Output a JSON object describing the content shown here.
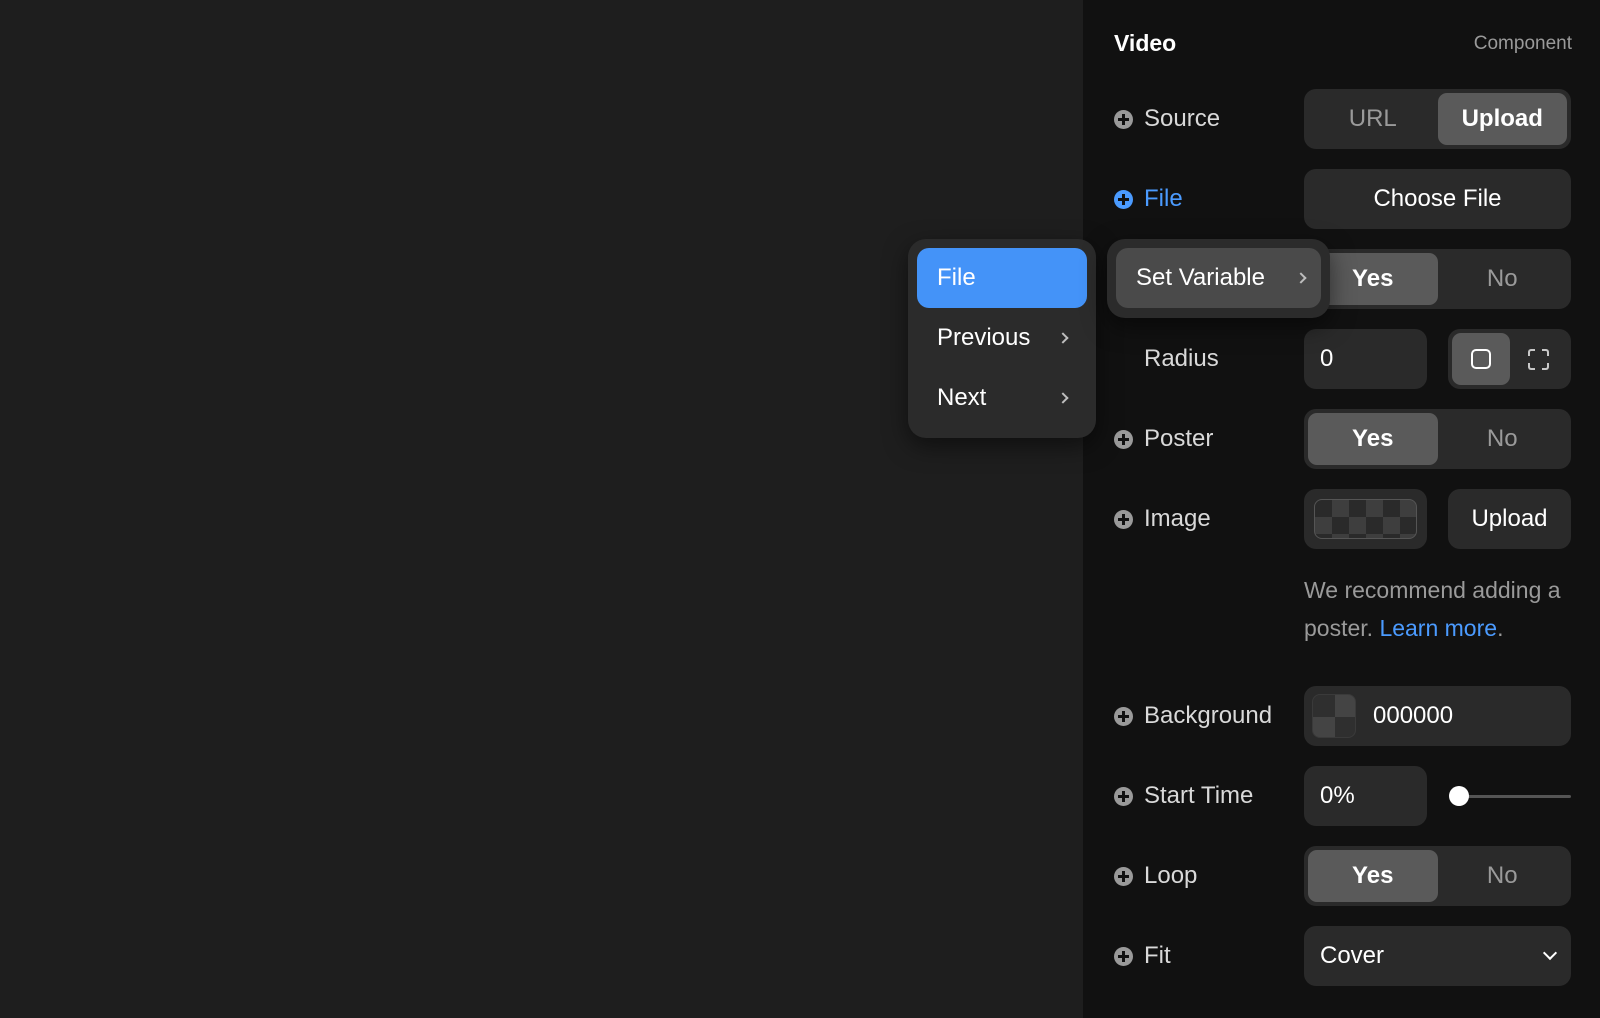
{
  "panel": {
    "title": "Video",
    "subtitle": "Component",
    "source": {
      "label": "Source",
      "options": [
        "URL",
        "Upload"
      ],
      "selected": "Upload"
    },
    "file": {
      "label": "File",
      "button": "Choose File"
    },
    "autoplay": {
      "options": [
        "Yes",
        "No"
      ],
      "selected": "Yes"
    },
    "radius": {
      "label": "Radius",
      "value": "0"
    },
    "poster": {
      "label": "Poster",
      "options": [
        "Yes",
        "No"
      ],
      "selected": "Yes"
    },
    "image": {
      "label": "Image",
      "button": "Upload"
    },
    "hint": {
      "text": "We recommend adding a poster. ",
      "link": "Learn more",
      "after": "."
    },
    "background": {
      "label": "Background",
      "value": "000000"
    },
    "start_time": {
      "label": "Start Time",
      "value": "0%",
      "slider_fraction": 0
    },
    "loop": {
      "label": "Loop",
      "options": [
        "Yes",
        "No"
      ],
      "selected": "Yes"
    },
    "fit": {
      "label": "Fit",
      "value": "Cover"
    }
  },
  "menu": {
    "items": [
      {
        "label": "File",
        "selected": true,
        "has_submenu": false
      },
      {
        "label": "Previous",
        "selected": false,
        "has_submenu": true
      },
      {
        "label": "Next",
        "selected": false,
        "has_submenu": true
      }
    ],
    "submenu": {
      "label": "Set Variable"
    }
  },
  "colors": {
    "accent": "#4b9bff",
    "menu_selected": "#4493f8",
    "panel_bg": "#111111",
    "canvas_bg": "#1e1e1e",
    "control_bg": "#2a2a2a",
    "segment_selected": "#5a5a5a"
  },
  "icons": [
    "plus-circle-icon",
    "chevron-right-icon",
    "chevron-down-icon",
    "square-icon",
    "expand-icon"
  ]
}
